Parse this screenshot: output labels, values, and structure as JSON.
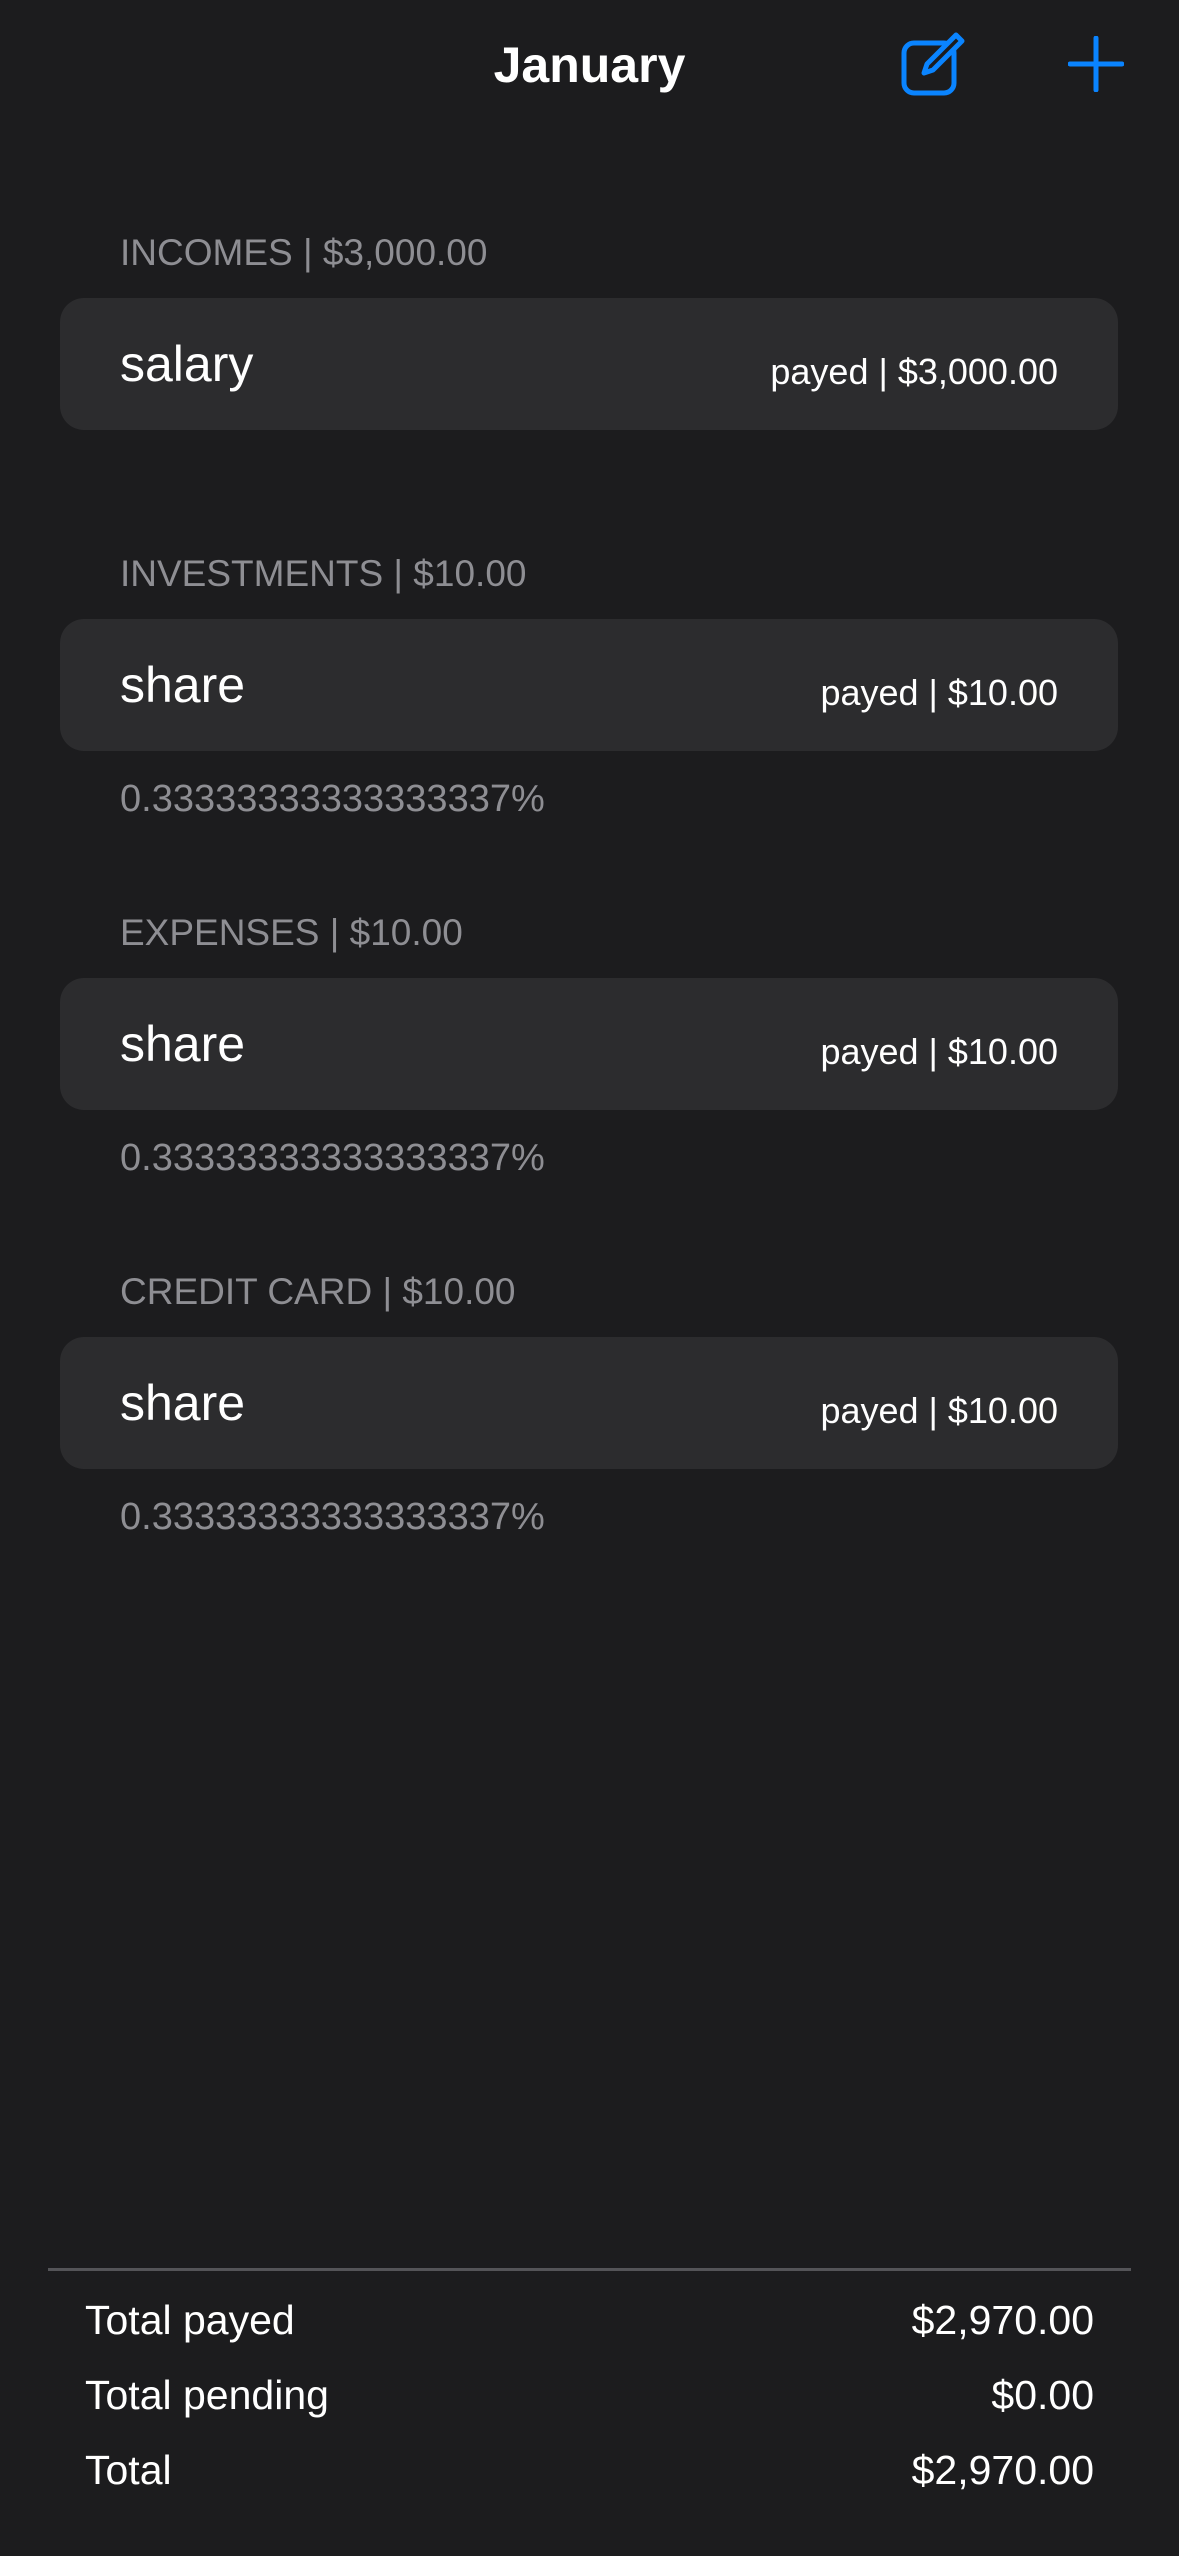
{
  "nav": {
    "title": "January",
    "compose_icon": "compose-icon",
    "add_icon": "plus-icon",
    "accent": "#0a84ff"
  },
  "sections": [
    {
      "header": "INCOMES | $3,000.00",
      "item": {
        "name": "salary",
        "status": "payed | $3,000.00"
      }
    },
    {
      "header": "INVESTMENTS | $10.00",
      "item": {
        "name": "share",
        "status": "payed | $10.00"
      },
      "percent": "0.33333333333333337%"
    },
    {
      "header": "EXPENSES | $10.00",
      "item": {
        "name": "share",
        "status": "payed | $10.00"
      },
      "percent": "0.33333333333333337%"
    },
    {
      "header": "CREDIT CARD | $10.00",
      "item": {
        "name": "share",
        "status": "payed | $10.00"
      },
      "percent": "0.33333333333333337%"
    }
  ],
  "summary": {
    "payed_label": "Total payed",
    "payed_value": "$2,970.00",
    "pending_label": "Total pending",
    "pending_value": "$0.00",
    "total_label": "Total",
    "total_value": "$2,970.00"
  }
}
